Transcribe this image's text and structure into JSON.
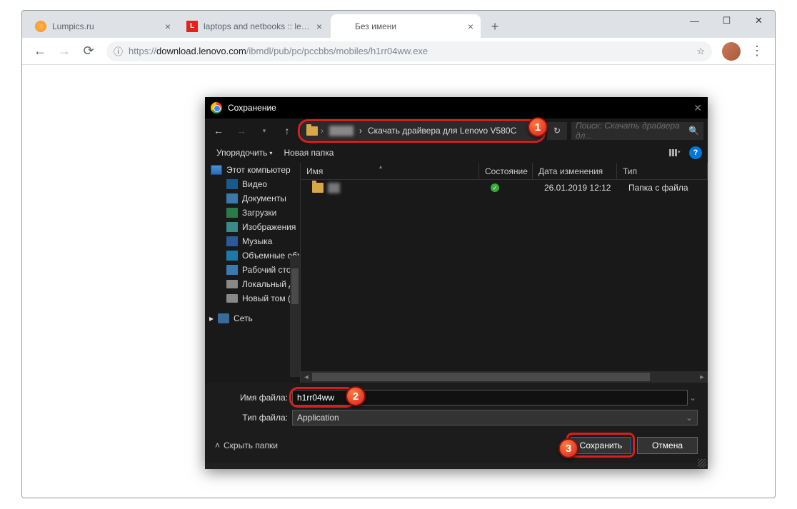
{
  "browser": {
    "tabs": [
      {
        "title": "Lumpics.ru",
        "favicon": "orange"
      },
      {
        "title": "laptops and netbooks :: lenovo v",
        "favicon": "lenovo"
      },
      {
        "title": "Без имени",
        "favicon": "blank"
      }
    ],
    "url_protocol": "https://",
    "url_host": "download.lenovo.com",
    "url_path": "/ibmdl/pub/pc/pccbbs/mobiles/h1rr04ww.exe",
    "window": {
      "min": "—",
      "max": "☐",
      "close": "✕"
    }
  },
  "dialog": {
    "title": "Сохранение",
    "nav": {
      "back": "←",
      "fwd": "→",
      "up": "↑"
    },
    "breadcrumb": {
      "segment1": "",
      "segment2": "Скачать драйвера для Lenovo V580C"
    },
    "search_placeholder": "Поиск: Скачать драйвера дл...",
    "toolbar": {
      "organize": "Упорядочить",
      "organize_arrow": "▾",
      "newfolder": "Новая папка"
    },
    "columns": {
      "name": "Имя",
      "state": "Состояние",
      "date": "Дата изменения",
      "type": "Тип"
    },
    "tree": {
      "thispc": "Этот компьютер",
      "video": "Видео",
      "documents": "Документы",
      "downloads": "Загрузки",
      "images": "Изображения",
      "music": "Музыка",
      "objects3d": "Объемные объ",
      "desktop": "Рабочий стол",
      "localdisk": "Локальный дис",
      "newvol": "Новый том (D:)",
      "network": "Сеть"
    },
    "files": [
      {
        "name": "",
        "date": "26.01.2019 12:12",
        "type": "Папка с файла"
      }
    ],
    "filename_label": "Имя файла:",
    "filename_value": "h1rr04ww",
    "filetype_label": "Тип файла:",
    "filetype_value": "Application",
    "hide_folders": "Скрыть папки",
    "save": "Сохранить",
    "cancel": "Отмена"
  },
  "annotations": {
    "b1": "1",
    "b2": "2",
    "b3": "3"
  }
}
